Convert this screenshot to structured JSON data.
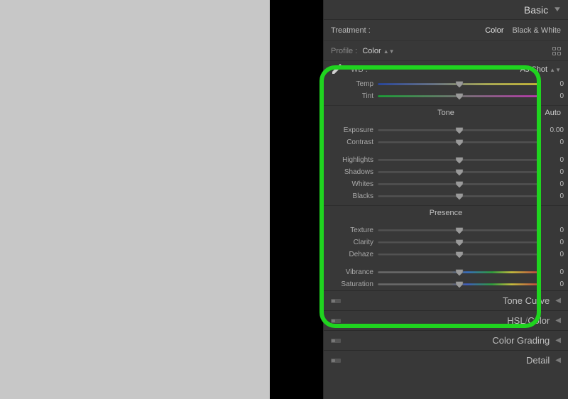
{
  "panel": {
    "title": "Basic",
    "treatment_label": "Treatment :",
    "treatment_options": {
      "color": "Color",
      "bw": "Black & White"
    },
    "profile_label": "Profile :",
    "profile_value": "Color"
  },
  "wb": {
    "label": "WB :",
    "value": "As Shot",
    "sliders": [
      {
        "label": "Temp",
        "value": "0",
        "track": "temp",
        "pos": 50
      },
      {
        "label": "Tint",
        "value": "0",
        "track": "tint",
        "pos": 50
      }
    ]
  },
  "tone": {
    "title": "Tone",
    "auto": "Auto",
    "groups": [
      [
        {
          "label": "Exposure",
          "value": "0.00",
          "track": "",
          "pos": 50
        },
        {
          "label": "Contrast",
          "value": "0",
          "track": "",
          "pos": 50
        }
      ],
      [
        {
          "label": "Highlights",
          "value": "0",
          "track": "",
          "pos": 50
        },
        {
          "label": "Shadows",
          "value": "0",
          "track": "",
          "pos": 50
        },
        {
          "label": "Whites",
          "value": "0",
          "track": "",
          "pos": 50
        },
        {
          "label": "Blacks",
          "value": "0",
          "track": "",
          "pos": 50
        }
      ]
    ]
  },
  "presence": {
    "title": "Presence",
    "groups": [
      [
        {
          "label": "Texture",
          "value": "0",
          "track": "",
          "pos": 50
        },
        {
          "label": "Clarity",
          "value": "0",
          "track": "",
          "pos": 50
        },
        {
          "label": "Dehaze",
          "value": "0",
          "track": "",
          "pos": 50
        }
      ],
      [
        {
          "label": "Vibrance",
          "value": "0",
          "track": "vib",
          "pos": 50
        },
        {
          "label": "Saturation",
          "value": "0",
          "track": "sat",
          "pos": 50
        }
      ]
    ]
  },
  "collapsed_panels": [
    {
      "title_html": "Tone Curve"
    },
    {
      "title_html": "HSL/Color",
      "split": [
        "HSL",
        "/",
        "Color"
      ]
    },
    {
      "title_html": "Color Grading"
    },
    {
      "title_html": "Detail"
    }
  ]
}
